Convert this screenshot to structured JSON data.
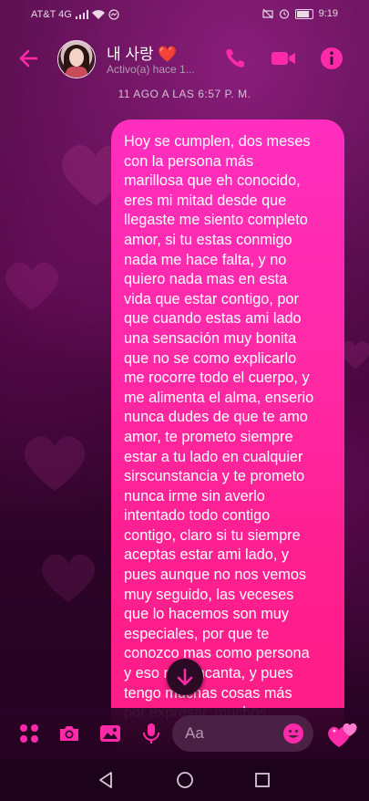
{
  "status_bar": {
    "carrier": "AT&T 4G",
    "time": "9:19"
  },
  "header": {
    "contact_name": "내 사랑 ❤️",
    "contact_status": "Activo(a) hace 1...",
    "icons": [
      "back-arrow-icon",
      "phone-icon",
      "video-camera-icon",
      "info-icon"
    ]
  },
  "conversation": {
    "date_label": "11 AGO A LAS 6:57 P. M.",
    "message_text": "Hoy se cumplen, dos meses\ncon la persona más\nmarillosa que eh conocido,\neres mi mitad desde que\nllegaste me siento completo\namor, si tu estas conmigo\nnada me hace falta, y no\nquiero nada mas en esta\nvida que estar contigo, por\nque cuando estas ami lado\nuna sensación muy bonita\nque no se como explicarlo\nme rocorre todo el cuerpo, y\nme alimenta el alma, enserio\nnunca dudes de que te amo\namor, te prometo siempre\nestar a tu lado en cualquier\nsirscunstancia y te prometo\nnunca irme sin averlo\nintentado todo contigo\ncontigo, claro si tu siempre\naceptas estar ami lado, y\npues aunque no nos vemos\nmuy seguido, las veceses\nque lo hacemos son muy\nespeciales, por que te\nconozco mas como persona\ny eso me encanta, y pues\ntengo muchas cosas más\npor expresar, muchos"
  },
  "composer": {
    "placeholder": "Aa",
    "icons": [
      "apps-grid-icon",
      "camera-icon",
      "gallery-icon",
      "microphone-icon",
      "emoji-icon",
      "hearts-sticker-icon"
    ]
  },
  "colors": {
    "accent": "#ff2aa8",
    "bubble_top": "#ff2ebf",
    "bubble_bottom": "#ff1d84"
  }
}
